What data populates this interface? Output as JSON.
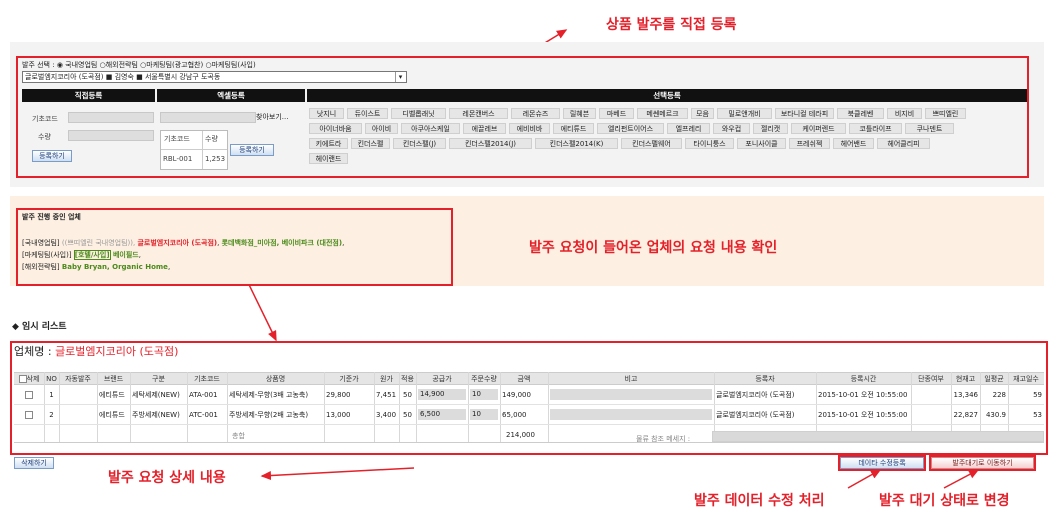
{
  "annotations": {
    "top": "상품 발주를 직접 등록",
    "middle": "발주 요청이 들어온 업체의 요청 내용 확인",
    "detail": "발주 요청 상세 내용",
    "edit": "발주 데이터 수정 처리",
    "wait": "발주 대기 상태로 변경"
  },
  "order_form": {
    "select_label": "발주 선택 :",
    "radio_options": [
      "국내영업팀",
      "해외전략팀",
      "마케팅팀(광고협찬)",
      "마케팅팀(사입)"
    ],
    "selected_index": 0,
    "company_select_value": "글로벌엠지코리아 (도곡점) ■ 김영숙 ■ 서울특별시 강남구 도곡동",
    "direct_header": "직접등록",
    "excel_header": "엑셀등록",
    "select_header": "선택등록",
    "barcode_label": "기초코드",
    "qty_label": "수량",
    "register_button": "등록하기",
    "browse_button": "찾아보기...",
    "excel_col_barcode": "기초코드",
    "excel_col_qty": "수량",
    "excel_row_code": "RBL-001",
    "excel_row_qty": "1,253",
    "excel_register_button": "등록하기",
    "brands_row1": [
      "낫지니",
      "듀이스트",
      "디벨롭래닛",
      "레몬캔버스",
      "레몬슈즈",
      "릴혜븐",
      "마베드",
      "메쎈메르크",
      "모음",
      "밀로앤개비",
      "보타니컬 테라피",
      "북클레벤",
      "비지비",
      "쁘띠엘린"
    ],
    "brands_row2": [
      "아이너바움",
      "아이비",
      "아쿠아스케일",
      "에끌레브",
      "에비비바",
      "에티튜드",
      "엘리펀트이어스",
      "엘프레리",
      "와우컵",
      "젤리캣",
      "케이퍼렌드",
      "코틀라이프",
      "쿠나덴트"
    ],
    "brands_row3": [
      "키에트라",
      "킨더스펠",
      "킨더스펠(J)",
      "킨더스펠2014(J)",
      "킨더스펠2014(K)",
      "킨더스펠웨어",
      "타이니퉁스",
      "포니사이클",
      "프레쉬젝",
      "헤어밴드",
      "헤어클리피"
    ],
    "brands_row4": [
      "헤이랜드"
    ]
  },
  "in_progress": {
    "title": "발주 진행 중인 업체",
    "line1_prefix": "[국내영업팀] ",
    "line1_grey": "((쁘띠엘린 국내영업팀)), ",
    "line1_red": "글로벌엠지코리아 (도곡점)",
    "line1_sep": ", ",
    "line1_green": "롯데백화점_미아점, 베이비파크 (대전점)",
    "line1_end": ",",
    "line2_prefix": "[마케팅팀(사입)] ",
    "line2_box": "[호텔/사입]",
    "line2_green": " 베이필드",
    "line2_end": ",",
    "line3_prefix": "[해외전략팀] ",
    "line3_green": "Baby Bryan, Organic Home",
    "line3_end": ","
  },
  "temp_list": {
    "heading": "◆ 임시 리스트",
    "company_label": "업체명 :",
    "company_name": "글로벌엠지코리아 (도곡점)",
    "columns": [
      "삭제",
      "NO",
      "자동발주",
      "브랜드",
      "구분",
      "기초코드",
      "상품명",
      "기준가",
      "원가",
      "적용",
      "공급가",
      "주문수량",
      "금액",
      "비고",
      "등록자",
      "등록시간",
      "단종여부",
      "현재고",
      "일평균",
      "재고일수"
    ],
    "rows": [
      {
        "no": "1",
        "auto": "",
        "brand": "에티튜드",
        "type": "세탁세제(NEW)",
        "code": "ATA-001",
        "name": "세탁세제-무향(3배 고농축)",
        "base": "29,800",
        "cost": "7,451",
        "rate": "50",
        "supply": "14,900",
        "qty": "10",
        "amount": "149,000",
        "registrant": "글로벌엠지코리아 (도곡점)",
        "time": "2015-10-01 오전 10:55:00",
        "discontinued": "",
        "stock": "13,346",
        "avg": "228",
        "days": "59"
      },
      {
        "no": "2",
        "auto": "",
        "brand": "에티튜드",
        "type": "주방세제(NEW)",
        "code": "ATC-001",
        "name": "주방세제-무향(2배 고농축)",
        "base": "13,000",
        "cost": "3,400",
        "rate": "50",
        "supply": "6,500",
        "qty": "10",
        "amount": "65,000",
        "registrant": "글로벌엠지코리아 (도곡점)",
        "time": "2015-10-01 오전 10:55:00",
        "discontinued": "",
        "stock": "22,827",
        "avg": "430.9",
        "days": "53"
      }
    ],
    "total_label": "총합",
    "total_amount": "214,000",
    "logistics_label": "물류 참조 메세지 :",
    "delete_button": "삭제하기",
    "edit_button": "데이타 수정등록",
    "move_button": "발주대기로 이동하기"
  }
}
